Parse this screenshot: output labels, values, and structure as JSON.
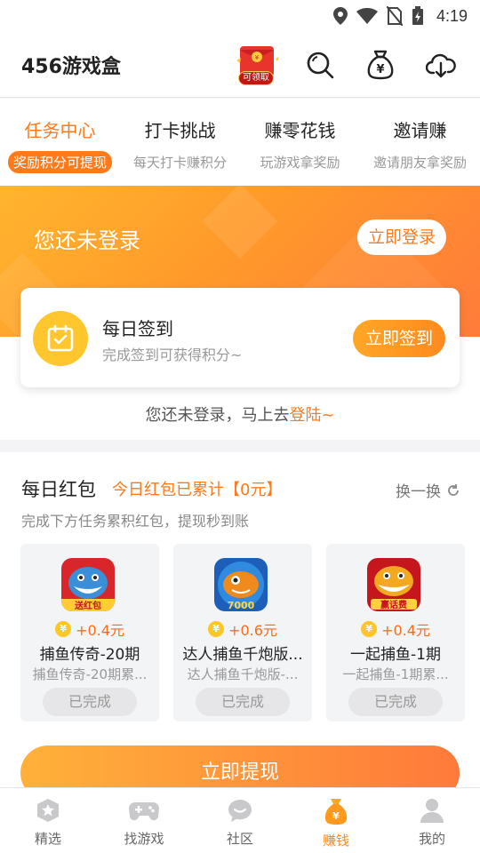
{
  "status_bar": {
    "time": "4:19"
  },
  "header": {
    "title": "456游戏盒",
    "redpacket_label": "可领取"
  },
  "tabs": [
    {
      "title": "任务中心",
      "subtitle": "奖励积分可提现"
    },
    {
      "title": "打卡挑战",
      "subtitle": "每天打卡赚积分"
    },
    {
      "title": "赚零花钱",
      "subtitle": "玩游戏拿奖励"
    },
    {
      "title": "邀请赚",
      "subtitle": "邀请朋友拿奖励"
    }
  ],
  "hero": {
    "not_logged_in": "您还未登录",
    "login_button": "立即登录"
  },
  "signin": {
    "title": "每日签到",
    "subtitle": "完成签到可获得积分~",
    "button": "立即签到"
  },
  "login_tip": {
    "text": "您还未登录，马上去",
    "link": "登陆~"
  },
  "redpacket": {
    "title": "每日红包",
    "total": "今日红包已累计【0元】",
    "swap": "换一换",
    "description": "完成下方任务累积红包，提现秒到账",
    "games": [
      {
        "reward": "+0.4元",
        "name": "捕鱼传奇-20期",
        "sub": "捕鱼传奇-20期累...",
        "status": "已完成",
        "badge": "送红包"
      },
      {
        "reward": "+0.6元",
        "name": "达人捕鱼千炮版...",
        "sub": "达人捕鱼千炮版-...",
        "status": "已完成",
        "badge": "7000"
      },
      {
        "reward": "+0.4元",
        "name": "一起捕鱼-1期",
        "sub": "一起捕鱼-1期累...",
        "status": "已完成",
        "badge": "赢话费"
      }
    ],
    "withdraw_button": "立即提现"
  },
  "bottom_nav": [
    {
      "label": "精选",
      "icon": "star-icon"
    },
    {
      "label": "找游戏",
      "icon": "gamepad-icon"
    },
    {
      "label": "社区",
      "icon": "chat-icon"
    },
    {
      "label": "赚钱",
      "icon": "money-bag-icon"
    },
    {
      "label": "我的",
      "icon": "user-icon"
    }
  ],
  "colors": {
    "accent": "#ff7a1a",
    "hero_start": "#ffb52e",
    "hero_end": "#ff7b3a"
  }
}
